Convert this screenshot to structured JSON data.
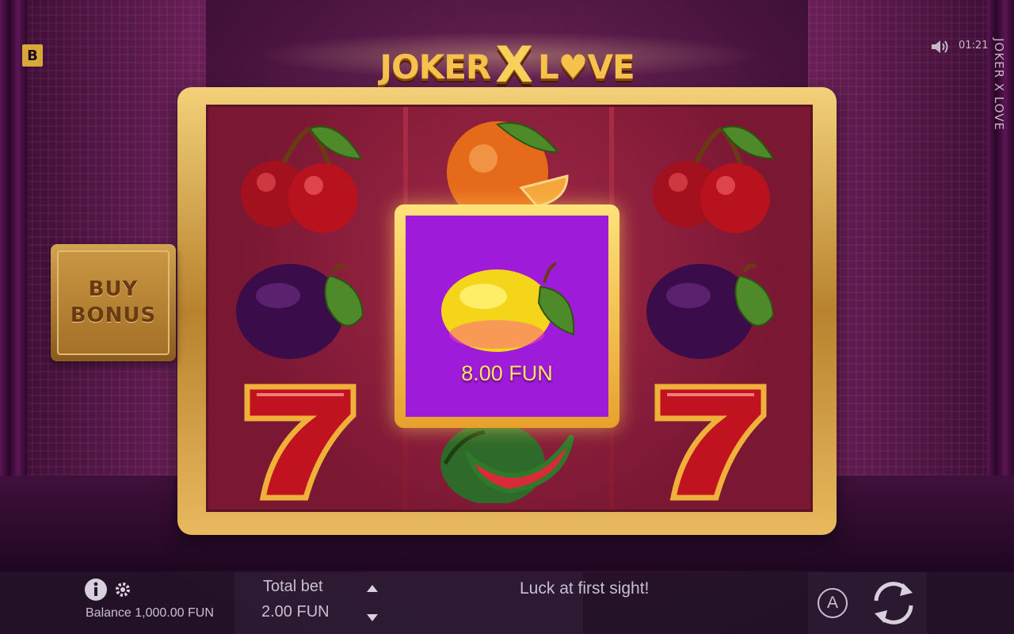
{
  "brand": {
    "badge": "B"
  },
  "status": {
    "time": "01:21",
    "sound_icon": "speaker-icon"
  },
  "game": {
    "side_title": "JOKER X LOVE",
    "logo_left": "JOKER",
    "logo_x": "X",
    "logo_right": "L♥VE"
  },
  "buy_bonus": {
    "line1": "BUY",
    "line2": "BONUS"
  },
  "win": {
    "amount": "8.00 FUN",
    "symbol": "lemon"
  },
  "reels": [
    [
      "cherry",
      "plum",
      "seven"
    ],
    [
      "orange",
      "lemon",
      "watermelon"
    ],
    [
      "cherry",
      "plum",
      "seven"
    ]
  ],
  "hud": {
    "info_icon": "info-icon",
    "settings_icon": "gear-icon",
    "balance_label": "Balance 1,000.00 FUN",
    "total_bet_label": "Total bet",
    "total_bet_value": "2.00 FUN",
    "message": "Luck at first sight!",
    "autoplay_label": "A",
    "spin_icon": "spin-icon"
  },
  "colors": {
    "gold": "#f3d079",
    "win_bg": "#9d1bd9",
    "win_text": "#ffe16a",
    "reel_bg": "#7a1733"
  }
}
